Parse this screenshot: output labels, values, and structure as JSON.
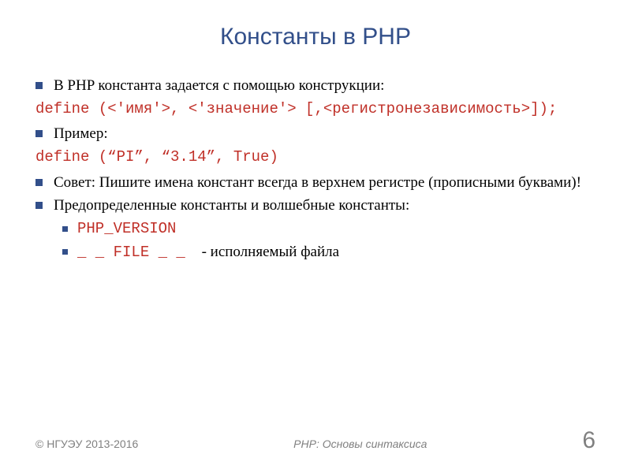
{
  "title": "Константы в PHP",
  "bullets": {
    "b1": "В PHP константа задается с помощью  конструкции:",
    "code1": "define (<'имя'>, <'значение'> [,<регистронезависимость>]);",
    "b2": "Пример:",
    "code2": "define (“PI”, “3.14”, True)",
    "b3": "Совет: Пишите имена констант всегда в верхнем регистре (прописными буквами)!",
    "b4": "Предопределенные константы и волшебные константы:",
    "sub1": "PHP_VERSION",
    "sub2": "_ _ FILE _ _",
    "sub2_ann": "- исполняемый файла"
  },
  "footer": {
    "copyright": "© НГУЭУ 2013-2016",
    "doctitle": "PHP: Основы синтаксиса",
    "page": "6"
  }
}
